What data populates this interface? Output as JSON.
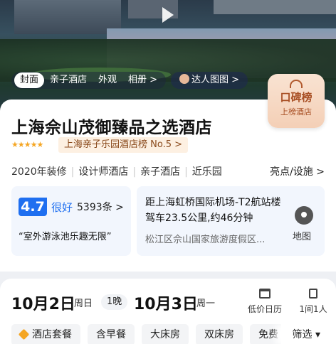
{
  "hero": {
    "tabs": [
      {
        "label": "封面",
        "active": true
      },
      {
        "label": "亲子酒店",
        "active": false
      },
      {
        "label": "外观",
        "active": false
      },
      {
        "label": "相册 >",
        "active": false
      }
    ],
    "talent_label": "达人图图 >",
    "play_icon": "play-icon"
  },
  "badge": {
    "title": "口碑榜",
    "subtitle": "上榜酒店"
  },
  "hotel": {
    "name": "上海佘山茂御臻品之选酒店",
    "stars": "★★★★★",
    "rank": "上海亲子乐园酒店榜 No.5 >",
    "tags": [
      "2020年装修",
      "设计师酒店",
      "亲子酒店",
      "近乐园"
    ],
    "highlights": "亮点/设施 >",
    "score": "4.7",
    "score_word": "很好",
    "reviews": "5393条 >",
    "quote": "“室外游泳池乐趣无限”",
    "location_main": "距上海虹桥国际机场-T2航站楼驾车23.5公里,约46分钟",
    "location_sub": "松江区佘山国家旅游度假区...",
    "map_label": "地图"
  },
  "booking": {
    "checkin_date": "10月2日",
    "checkin_weekday": "周日",
    "nights": "1晚",
    "checkout_date": "10月3日",
    "checkout_weekday": "周一",
    "calendar_label": "低价日历",
    "guests_label": "1间1人",
    "filters": [
      "酒店套餐",
      "含早餐",
      "大床房",
      "双床房",
      "免费"
    ],
    "filter_button": "筛选 ▾"
  },
  "colors": {
    "accent": "#1f6ff0",
    "badge": "#a84f24",
    "star": "#f5a623"
  }
}
